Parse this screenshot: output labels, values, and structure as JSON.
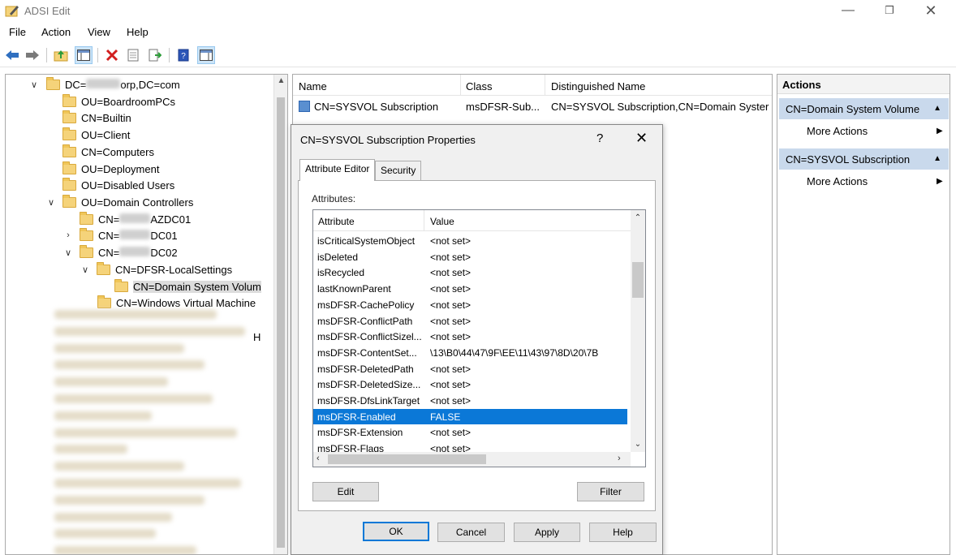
{
  "window": {
    "title": "ADSI Edit"
  },
  "menu": [
    "File",
    "Action",
    "View",
    "Help"
  ],
  "tree": {
    "root": {
      "prefix": "DC=",
      "suffix": "orp,DC=com"
    },
    "items": [
      "OU=BoardroomPCs",
      "CN=Builtin",
      "OU=Client",
      "CN=Computers",
      "OU=Deployment",
      "OU=Disabled Users",
      "OU=Domain Controllers"
    ],
    "dc1": {
      "prefix": "CN=",
      "suffix": "AZDC01"
    },
    "dc2": {
      "prefix": "CN=",
      "suffix": "DC01"
    },
    "dc3": {
      "prefix": "CN=",
      "suffix": "DC02"
    },
    "dfsr": "CN=DFSR-LocalSettings",
    "dsv": "CN=Domain System Volum",
    "wvm": "CN=Windows Virtual Machine",
    "stray_char": "H"
  },
  "list": {
    "columns": [
      "Name",
      "Class",
      "Distinguished Name"
    ],
    "row": {
      "name": "CN=SYSVOL Subscription",
      "class": "msDFSR-Sub...",
      "dn": "CN=SYSVOL Subscription,CN=Domain Syster"
    }
  },
  "dialog": {
    "title": "CN=SYSVOL Subscription Properties",
    "help": "?",
    "tabs": [
      "Attribute Editor",
      "Security"
    ],
    "attributes_label": "Attributes:",
    "columns": [
      "Attribute",
      "Value"
    ],
    "rows": [
      {
        "attr": "isCriticalSystemObject",
        "value": "<not set>"
      },
      {
        "attr": "isDeleted",
        "value": "<not set>"
      },
      {
        "attr": "isRecycled",
        "value": "<not set>"
      },
      {
        "attr": "lastKnownParent",
        "value": "<not set>"
      },
      {
        "attr": "msDFSR-CachePolicy",
        "value": "<not set>"
      },
      {
        "attr": "msDFSR-ConflictPath",
        "value": "<not set>"
      },
      {
        "attr": "msDFSR-ConflictSizel...",
        "value": "<not set>"
      },
      {
        "attr": "msDFSR-ContentSet...",
        "value": "\\13\\B0\\44\\47\\9F\\EE\\11\\43\\97\\8D\\20\\7B"
      },
      {
        "attr": "msDFSR-DeletedPath",
        "value": "<not set>"
      },
      {
        "attr": "msDFSR-DeletedSize...",
        "value": "<not set>"
      },
      {
        "attr": "msDFSR-DfsLinkTarget",
        "value": "<not set>"
      },
      {
        "attr": "msDFSR-Enabled",
        "value": "FALSE"
      },
      {
        "attr": "msDFSR-Extension",
        "value": "<not set>"
      },
      {
        "attr": "msDFSR-Flags",
        "value": "<not set>"
      }
    ],
    "selected_row_index": 11,
    "edit": "Edit",
    "filter": "Filter",
    "ok": "OK",
    "cancel": "Cancel",
    "apply": "Apply",
    "helpbtn": "Help"
  },
  "actions": {
    "header": "Actions",
    "sections": [
      {
        "title": "CN=Domain System Volume",
        "item": "More Actions"
      },
      {
        "title": "CN=SYSVOL Subscription",
        "item": "More Actions"
      }
    ]
  },
  "colors": {
    "selection": "#0b78d7",
    "action_section": "#c9d9ec",
    "folder": "#f5d37a"
  }
}
